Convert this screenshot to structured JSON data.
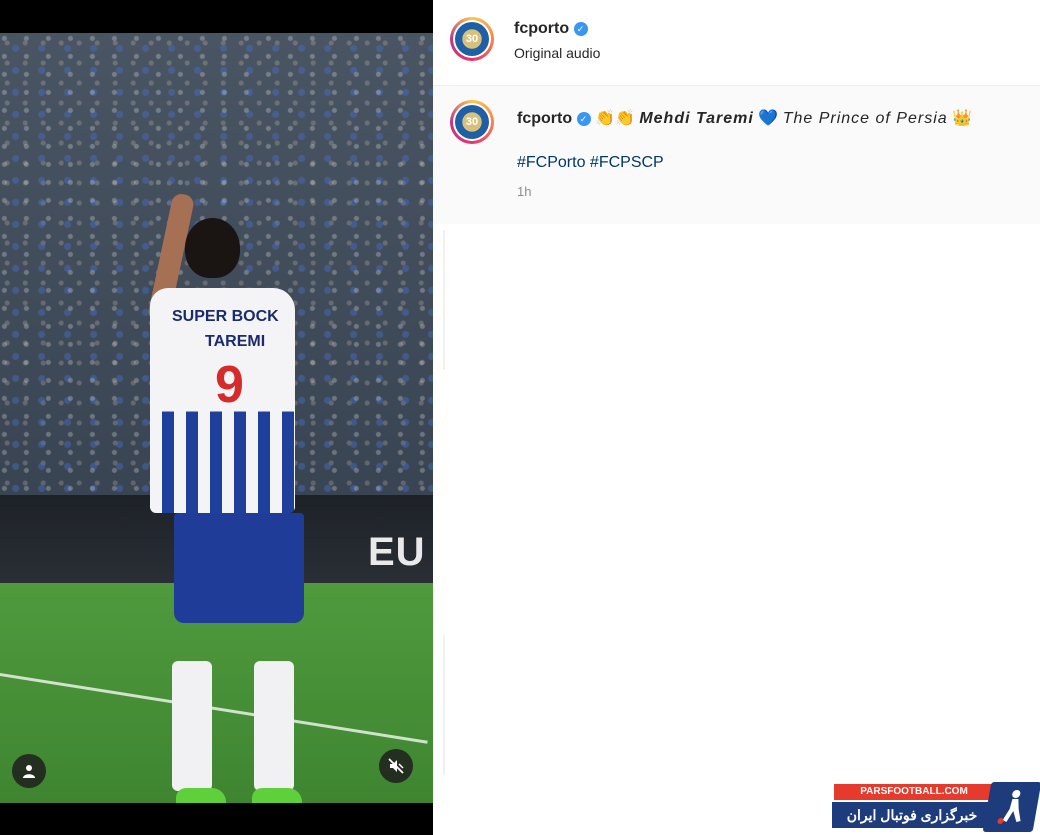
{
  "post": {
    "username": "fcporto",
    "audio_label": "Original audio",
    "avatar_text": "30",
    "caption": {
      "username": "fcporto",
      "clap_emojis": "👏👏",
      "player_name": "Mehdi Taremi",
      "heart_emoji": "💙",
      "title": "The Prince of Persia",
      "crown_emoji": "👑",
      "hashtags": "#FCPorto #FCPSCP",
      "time": "1h"
    }
  },
  "media": {
    "shirt_sponsor": "SUPER BOCK",
    "shirt_name": "TAREMI",
    "shirt_number": "9",
    "ad_board_text": "EU"
  },
  "watermark": {
    "top_text": "PARSFOOTBALL.COM",
    "bottom_text": "خبرگزاری فوتبال ایران"
  },
  "colors": {
    "hashtag": "#00376b",
    "verified": "#3897f0",
    "muted": "#8e8e8e"
  }
}
